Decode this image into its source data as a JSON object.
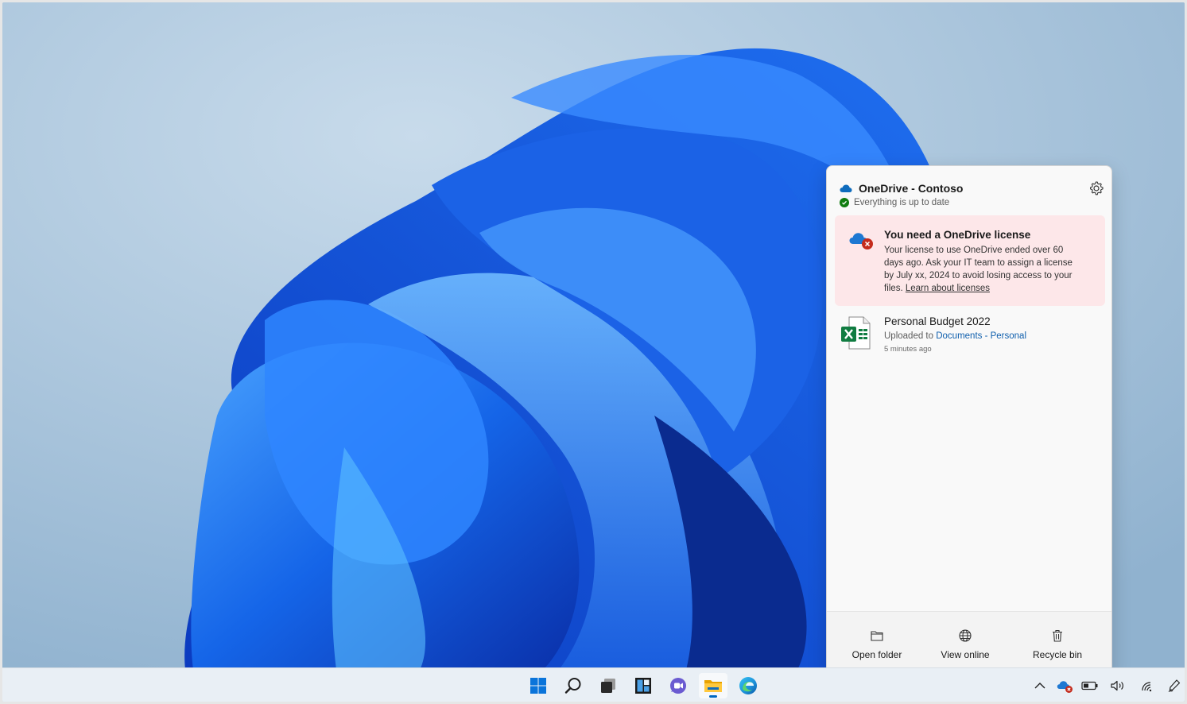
{
  "flyout": {
    "title": "OneDrive - Contoso",
    "status": "Everything is up to date",
    "alert": {
      "title": "You need a OneDrive license",
      "body": "Your license to use OneDrive ended over 60 days ago. Ask your IT team to assign a license by July xx, 2024 to avoid losing access to your files.",
      "link": "Learn about licenses"
    },
    "file": {
      "name": "Personal Budget 2022",
      "uploaded_prefix": "Uploaded to",
      "location": "Documents - Personal",
      "time": "5 minutes ago"
    },
    "footer": {
      "open_folder": "Open folder",
      "view_online": "View online",
      "recycle_bin": "Recycle bin"
    }
  },
  "taskbar": {
    "icons": [
      "start-icon",
      "search-icon",
      "task-view-icon",
      "widgets-icon",
      "teams-chat-icon",
      "file-explorer-icon",
      "edge-icon"
    ],
    "tray": [
      "chevron-up-icon",
      "onedrive-error-icon",
      "battery-icon",
      "volume-icon",
      "wifi-icon",
      "pen-icon"
    ]
  },
  "colors": {
    "accent": "#0067c0",
    "error": "#c42b1c",
    "success": "#107c10",
    "alert_bg": "#fde7e9",
    "excel_green": "#107c41"
  }
}
